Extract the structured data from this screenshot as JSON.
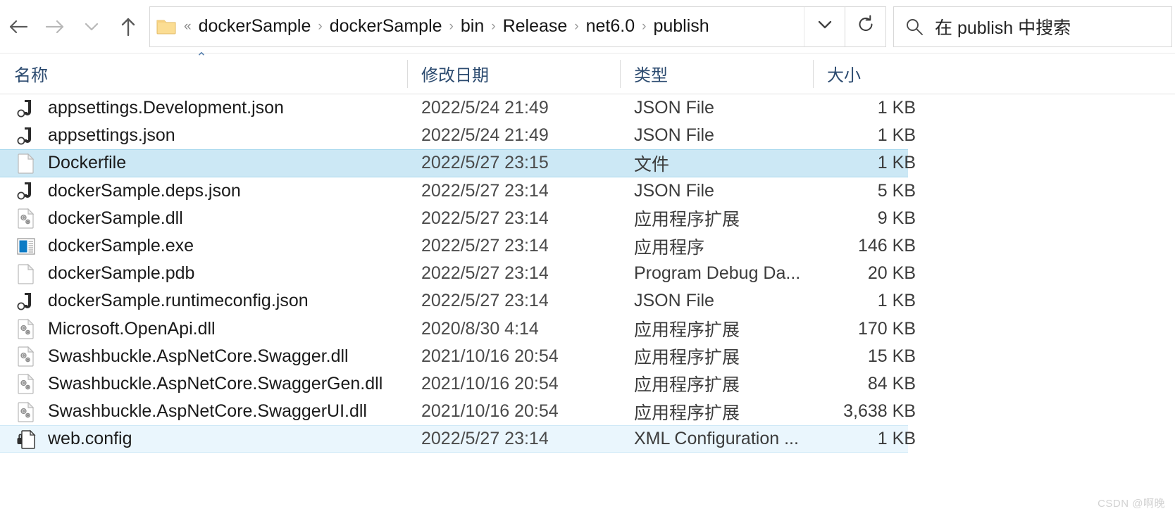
{
  "toolbar": {
    "back_button": {
      "icon": "arrow-left-icon",
      "enabled": true
    },
    "forward_button": {
      "icon": "arrow-right-icon",
      "enabled": false
    },
    "recent_button": {
      "icon": "chevron-down-icon",
      "enabled": false
    },
    "up_button": {
      "icon": "arrow-up-icon",
      "enabled": true
    },
    "address": {
      "folder_icon": "folder-icon",
      "overflow_indicator": "«",
      "separator": "›",
      "crumbs": [
        "dockerSample",
        "dockerSample",
        "bin",
        "Release",
        "net6.0",
        "publish"
      ],
      "dropdown_icon": "chevron-down-icon"
    },
    "refresh_button": {
      "icon": "refresh-icon",
      "label": "↻"
    },
    "search": {
      "icon": "search-icon",
      "placeholder": "在 publish 中搜索",
      "value": ""
    }
  },
  "columns": {
    "name": "名称",
    "date_modified": "修改日期",
    "type": "类型",
    "size": "大小",
    "sort_caret": "⌃",
    "sort_column": "名称",
    "sort_direction": "ascending"
  },
  "files": [
    {
      "name": "appsettings.Development.json",
      "date": "2022/5/24 21:49",
      "type": "JSON File",
      "size": "1 KB",
      "icon": "json-file-icon",
      "state": "normal"
    },
    {
      "name": "appsettings.json",
      "date": "2022/5/24 21:49",
      "type": "JSON File",
      "size": "1 KB",
      "icon": "json-file-icon",
      "state": "normal"
    },
    {
      "name": "Dockerfile",
      "date": "2022/5/27 23:15",
      "type": "文件",
      "size": "1 KB",
      "icon": "blank-file-icon",
      "state": "selected"
    },
    {
      "name": "dockerSample.deps.json",
      "date": "2022/5/27 23:14",
      "type": "JSON File",
      "size": "5 KB",
      "icon": "json-file-icon",
      "state": "normal"
    },
    {
      "name": "dockerSample.dll",
      "date": "2022/5/27 23:14",
      "type": "应用程序扩展",
      "size": "9 KB",
      "icon": "dll-file-icon",
      "state": "normal"
    },
    {
      "name": "dockerSample.exe",
      "date": "2022/5/27 23:14",
      "type": "应用程序",
      "size": "146 KB",
      "icon": "exe-file-icon",
      "state": "normal"
    },
    {
      "name": "dockerSample.pdb",
      "date": "2022/5/27 23:14",
      "type": "Program Debug Da...",
      "size": "20 KB",
      "icon": "blank-file-icon",
      "state": "normal"
    },
    {
      "name": "dockerSample.runtimeconfig.json",
      "date": "2022/5/27 23:14",
      "type": "JSON File",
      "size": "1 KB",
      "icon": "json-file-icon",
      "state": "normal"
    },
    {
      "name": "Microsoft.OpenApi.dll",
      "date": "2020/8/30 4:14",
      "type": "应用程序扩展",
      "size": "170 KB",
      "icon": "dll-file-icon",
      "state": "normal"
    },
    {
      "name": "Swashbuckle.AspNetCore.Swagger.dll",
      "date": "2021/10/16 20:54",
      "type": "应用程序扩展",
      "size": "15 KB",
      "icon": "dll-file-icon",
      "state": "normal"
    },
    {
      "name": "Swashbuckle.AspNetCore.SwaggerGen.dll",
      "date": "2021/10/16 20:54",
      "type": "应用程序扩展",
      "size": "84 KB",
      "icon": "dll-file-icon",
      "state": "normal"
    },
    {
      "name": "Swashbuckle.AspNetCore.SwaggerUI.dll",
      "date": "2021/10/16 20:54",
      "type": "应用程序扩展",
      "size": "3,638 KB",
      "icon": "dll-file-icon",
      "state": "normal"
    },
    {
      "name": "web.config",
      "date": "2022/5/27 23:14",
      "type": "XML Configuration ...",
      "size": "1 KB",
      "icon": "xml-config-file-icon",
      "state": "hovered"
    }
  ],
  "watermark": "CSDN @啊晚",
  "colors": {
    "selection": "#cce8f5",
    "hover": "#eaf6fd",
    "header_text": "#2b4a6f",
    "exe_accent": "#0b7ac4",
    "folder": "#fbdd93"
  }
}
